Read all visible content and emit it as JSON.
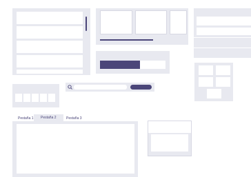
{
  "tabs": {
    "items": [
      {
        "label": "Pestaña 1"
      },
      {
        "label": "Pestaña 2"
      },
      {
        "label": "Pestaña 3"
      }
    ],
    "active_index": 1
  },
  "colors": {
    "panel_bg": "#e8e9f0",
    "accent": "#4b4679",
    "white": "#ffffff",
    "border": "#d7d8e3"
  },
  "icons": {
    "search": "search-icon"
  }
}
